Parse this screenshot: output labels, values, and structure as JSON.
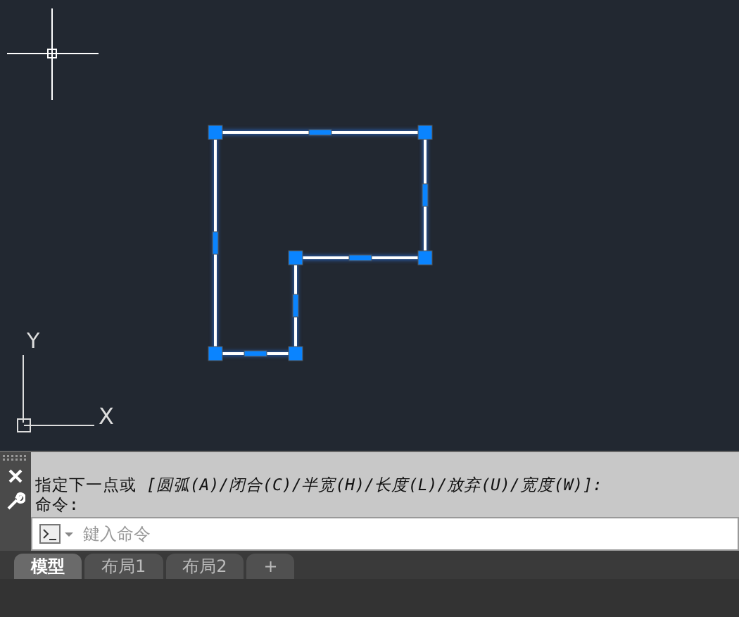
{
  "drawing": {
    "polyline": {
      "selected": true
    },
    "ucs": {
      "x_label": "X",
      "y_label": "Y"
    }
  },
  "command_line": {
    "history": [
      "指定下一点或 *[圆弧(A)/闭合(C)/半宽(H)/长度(L)/放弃(U)/宽度(W)]:*",
      "命令:"
    ],
    "placeholder": "鍵入命令"
  },
  "tabs": [
    {
      "label": "模型",
      "selected": true
    },
    {
      "label": "布局1",
      "selected": false
    },
    {
      "label": "布局2",
      "selected": false
    }
  ],
  "add_tab": "+"
}
